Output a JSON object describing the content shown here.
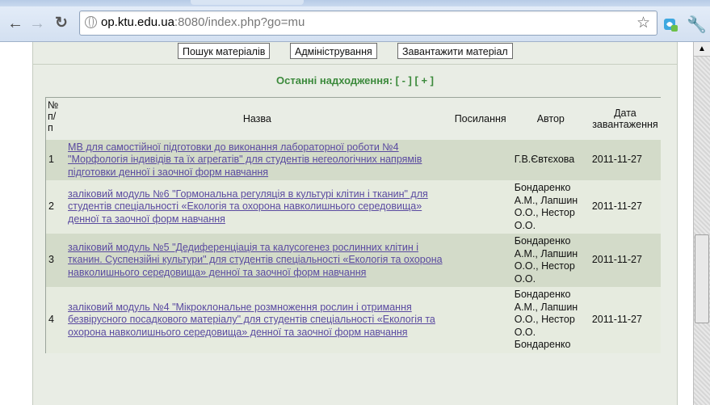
{
  "browser": {
    "url_host": "op.ktu.edu.ua",
    "url_rest": ":8080/index.php?go=mu"
  },
  "topbar": {
    "search_label": "Пошук матеріалів",
    "admin_label": "Адміністрування",
    "upload_label": "Завантажити матеріал"
  },
  "recent": {
    "label": "Останні надходження:",
    "collapse": "[ - ]",
    "expand": "[ + ]"
  },
  "table": {
    "headers": {
      "num": "№ п/ п",
      "title": "Назва",
      "link": "Посилання",
      "author": "Автор",
      "date": "Дата завантаження"
    },
    "rows": [
      {
        "num": "1",
        "title": "МВ для самостійної підготовки до виконання лабораторної роботи №4 \"Морфологія індивідів та їх агрегатів\" для студентів негеологічних напрямів підготовки денної і заочної форм навчання",
        "link": "",
        "author": "Г.В.Євтєхова",
        "date": "2011-11-27"
      },
      {
        "num": "2",
        "title": "заліковий модуль №6 \"Гормональна регуляція в культурі клітин і тканин\" для студентів спеціальності «Екологія та охорона навколишнього середовища» денної та заочної форм навчання",
        "link": "",
        "author": "Бондаренко А.М., Лапшин О.О., Нестор О.О.",
        "date": "2011-11-27"
      },
      {
        "num": "3",
        "title": "заліковий модуль №5 \"Дедиференціація та калусогенез рослинних клітин і тканин. Суспензійні культури\" для студентів спеціальності «Екологія та охорона навколишнього середовища» денної та заочної форм навчання",
        "link": "",
        "author": "Бондаренко А.М., Лапшин О.О., Нестор О.О.",
        "date": "2011-11-27"
      },
      {
        "num": "4",
        "title": "заліковий модуль №4 \"Мікроклональне розмноження рослин і отримання безвірусного посадкового матеріалу\" для студентів спеціальності «Екологія та охорона навколишнього середовища» денної та заочної форм навчання",
        "link": "",
        "author": "Бондаренко А.М., Лапшин О.О., Нестор О.О. Бондаренко",
        "date": "2011-11-27"
      }
    ]
  }
}
